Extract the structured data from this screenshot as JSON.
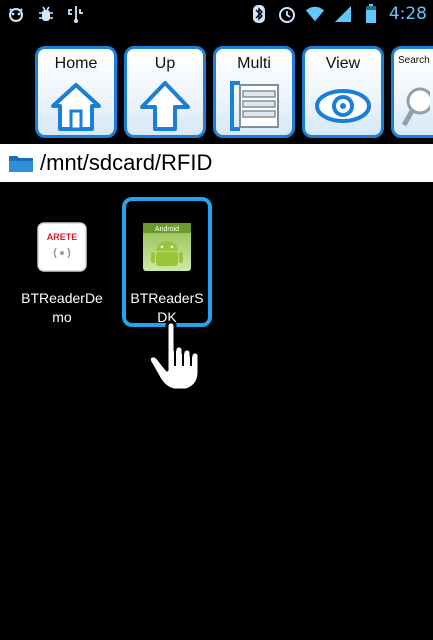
{
  "status_bar": {
    "time": "4:28",
    "icons": [
      "android-debug-icon",
      "usb-bug-icon",
      "usb-icon",
      "bluetooth-icon",
      "alarm-icon",
      "wifi-icon",
      "signal-icon",
      "battery-icon"
    ]
  },
  "toolbar": {
    "buttons": [
      {
        "label": "Home",
        "icon": "home-icon"
      },
      {
        "label": "Up",
        "icon": "up-arrow-icon"
      },
      {
        "label": "Multi",
        "icon": "list-icon"
      },
      {
        "label": "View",
        "icon": "eye-icon"
      },
      {
        "label": "Search",
        "icon": "search-icon"
      }
    ]
  },
  "path_bar": {
    "path": "/mnt/sdcard/RFID",
    "icon": "folder-icon"
  },
  "files": [
    {
      "name_line1": "BTReaderDe",
      "name_line2": "mo",
      "icon": "arete-app-icon",
      "icon_text": "ARETE",
      "selected": false
    },
    {
      "name_line1": "BTReaderS",
      "name_line2": "DK",
      "icon": "android-app-icon",
      "icon_text": "Android",
      "selected": true
    }
  ],
  "colors": {
    "accent": "#1a7fd6",
    "selection": "#24a3ee",
    "background": "#000000",
    "time": "#61c8ff"
  }
}
